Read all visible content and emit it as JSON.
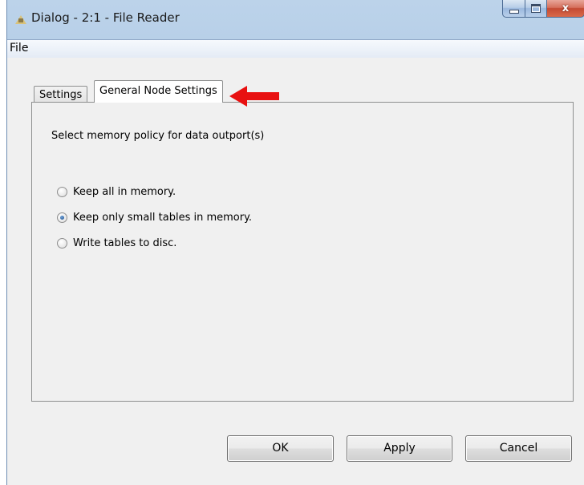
{
  "window": {
    "title": "Dialog - 2:1 - File Reader",
    "close_glyph": "x"
  },
  "menubar": {
    "items": [
      "File"
    ]
  },
  "tabs": [
    {
      "label": "Settings",
      "active": false
    },
    {
      "label": "General Node Settings",
      "active": true
    }
  ],
  "panel": {
    "heading": "Select memory policy for data outport(s)",
    "options": [
      {
        "label": "Keep all in memory.",
        "checked": false
      },
      {
        "label": "Keep only small tables in memory.",
        "checked": true
      },
      {
        "label": "Write tables to disc.",
        "checked": false
      }
    ]
  },
  "buttons": {
    "ok": "OK",
    "apply": "Apply",
    "cancel": "Cancel"
  },
  "annotation": {
    "arrow_color": "#e81010",
    "arrow_icon": "left-arrow-icon"
  }
}
